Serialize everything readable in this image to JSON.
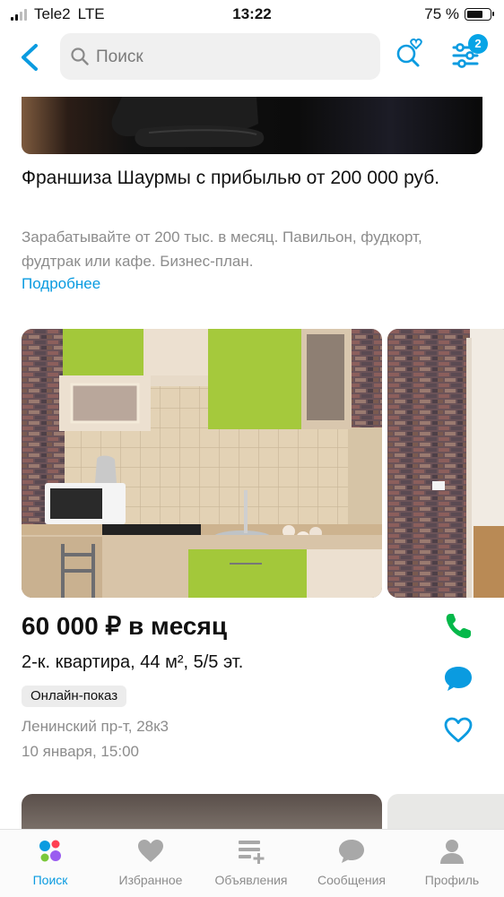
{
  "status_bar": {
    "carrier": "Tele2",
    "network": "LTE",
    "time": "13:22",
    "battery": "75 %",
    "battery_level": 0.75
  },
  "header": {
    "search_placeholder": "Поиск",
    "filter_badge": "2"
  },
  "ad": {
    "title": "Франшиза Шаурмы с прибылью от 200 000 руб.",
    "description": "Зарабатывайте от 200 тыс. в месяц. Павильон, фудкорт, фудтрак или кафе. Бизнес-план.",
    "more": "Подробнее"
  },
  "listing": {
    "price": "60 000 ₽ в месяц",
    "params": "2-к. квартира, 44 м², 5/5 эт.",
    "badge": "Онлайн-показ",
    "address": "Ленинский пр-т, 28к3",
    "date": "10 января, 15:00"
  },
  "tabs": [
    {
      "label": "Поиск",
      "icon": "search-tab-icon",
      "active": true
    },
    {
      "label": "Избранное",
      "icon": "heart-icon"
    },
    {
      "label": "Объявления",
      "icon": "listings-icon"
    },
    {
      "label": "Сообщения",
      "icon": "chat-icon"
    },
    {
      "label": "Профиль",
      "icon": "user-icon"
    }
  ],
  "colors": {
    "accent": "#0a9be0",
    "call": "#05b84a",
    "badge": "#06a4e6"
  }
}
